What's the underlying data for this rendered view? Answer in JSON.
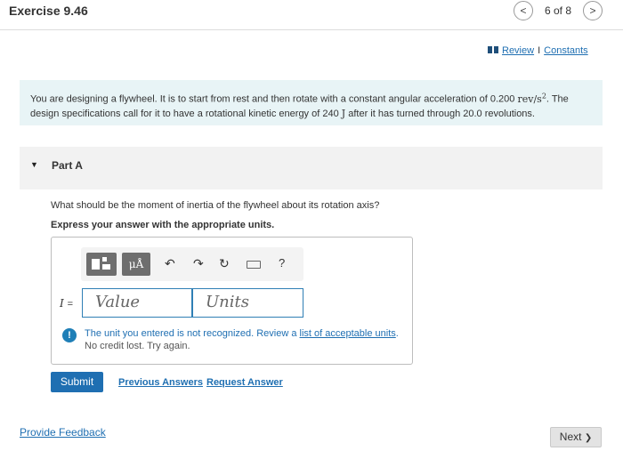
{
  "header": {
    "title": "Exercise 9.46",
    "prev_icon": "chevron-left-icon",
    "next_icon": "chevron-right-icon",
    "prev_glyph": "<",
    "next_glyph": ">",
    "page_counter": "6 of 8"
  },
  "links": {
    "icon": "book-icon",
    "review": "Review",
    "separator": "I",
    "constants": "Constants"
  },
  "problem": {
    "text_1": "You are designing a flywheel. It is to start from rest and then rotate with a constant angular acceleration of 0.200 ",
    "unit_accel": "rev/s",
    "unit_accel_exp": "2",
    "text_2": ". The design specifications call for it to have a rotational kinetic energy of 240 ",
    "unit_energy": "J",
    "text_3": " after it has turned through 20.0 revolutions."
  },
  "part": {
    "toggle_icon": "caret-down-icon",
    "toggle_glyph": "▼",
    "label": "Part A"
  },
  "question": "What should be the moment of inertia of the flywheel about its rotation axis?",
  "instruction": "Express your answer with the appropriate units.",
  "toolbar": {
    "templates_icon": "templates-icon",
    "units_icon": "units-icon",
    "units_label": "μÅ",
    "undo_icon": "undo-icon",
    "undo_glyph": "↶",
    "redo_icon": "redo-icon",
    "redo_glyph": "↷",
    "reset_icon": "reset-icon",
    "reset_glyph": "↻",
    "keyboard_icon": "keyboard-icon",
    "help_icon": "help-icon",
    "help_glyph": "?"
  },
  "answer": {
    "variable": "I",
    "equals": "=",
    "value_placeholder": "Value",
    "units_placeholder": "Units"
  },
  "error": {
    "icon": "exclamation-icon",
    "icon_glyph": "!",
    "message": "The unit you entered is not recognized. Review a ",
    "link": "list of acceptable units",
    "end": ".",
    "sub": "No credit lost. Try again."
  },
  "actions": {
    "submit": "Submit",
    "previous_answers": "Previous Answers",
    "request_answer": "Request Answer"
  },
  "footer": {
    "feedback": "Provide Feedback",
    "next": "Next",
    "next_icon": "chevron-right-icon",
    "next_glyph": "❯"
  }
}
